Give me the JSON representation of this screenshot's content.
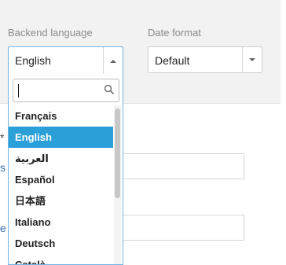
{
  "backend_language": {
    "label": "Backend language",
    "value": "English",
    "arrow_icon": "chevron-up-icon"
  },
  "date_format": {
    "label": "Date format",
    "value": "Default",
    "arrow_icon": "chevron-down-icon"
  },
  "dropdown": {
    "search_value": "",
    "search_icon": "search-icon",
    "options": [
      "Français",
      "English",
      "العربية",
      "Español",
      "日本語",
      "Italiano",
      "Deutsch",
      "Català"
    ],
    "selected_index": 1
  },
  "background": {
    "required_marker": "*",
    "partial_text_1": "s",
    "partial_text_2": "e"
  }
}
